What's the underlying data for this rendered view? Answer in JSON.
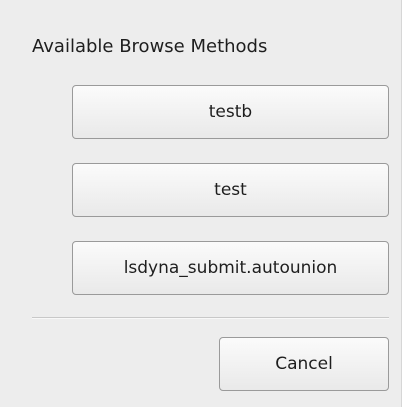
{
  "dialog": {
    "title": "Available Browse Methods",
    "methods": [
      {
        "label": "testb"
      },
      {
        "label": "test"
      },
      {
        "label": "lsdyna_submit.autounion"
      }
    ],
    "cancel_label": "Cancel"
  }
}
